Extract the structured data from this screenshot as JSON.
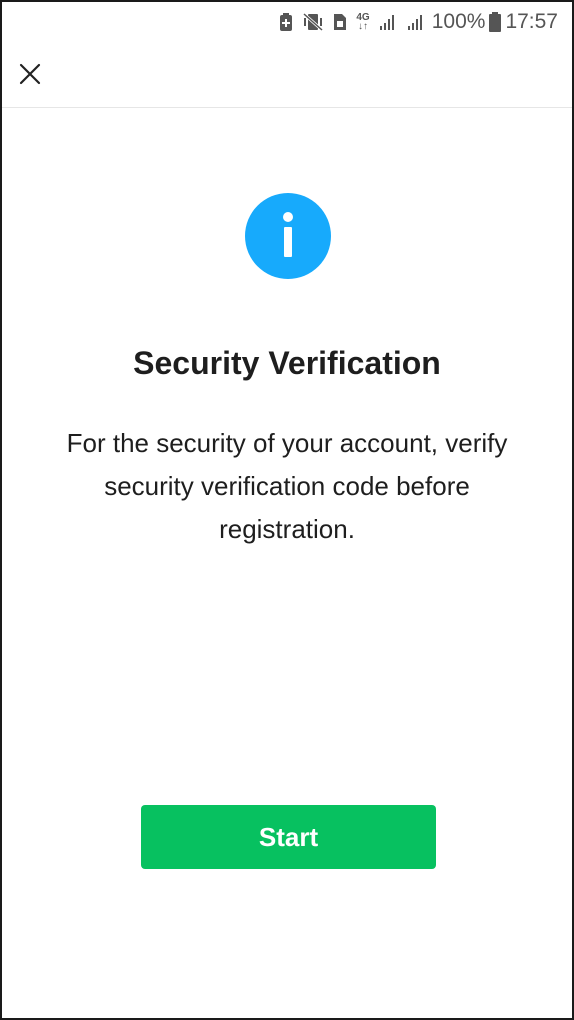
{
  "status_bar": {
    "icons": [
      "battery-saver-icon",
      "vibrate-icon",
      "sim-icon",
      "network-4g-icon",
      "signal-icon",
      "signal-icon",
      "battery-icon"
    ],
    "network_top": "4G",
    "network_bottom": "↓↑",
    "battery_percent": "100%",
    "time": "17:57"
  },
  "header": {
    "close_icon": "close-icon"
  },
  "main": {
    "icon": "info-icon",
    "title": "Security Verification",
    "description": "For the security of your account, verify security verification code before registration.",
    "start_label": "Start"
  },
  "colors": {
    "accent_blue": "#17aafc",
    "button_green": "#07c160",
    "text_dark": "#1e1e1e"
  }
}
